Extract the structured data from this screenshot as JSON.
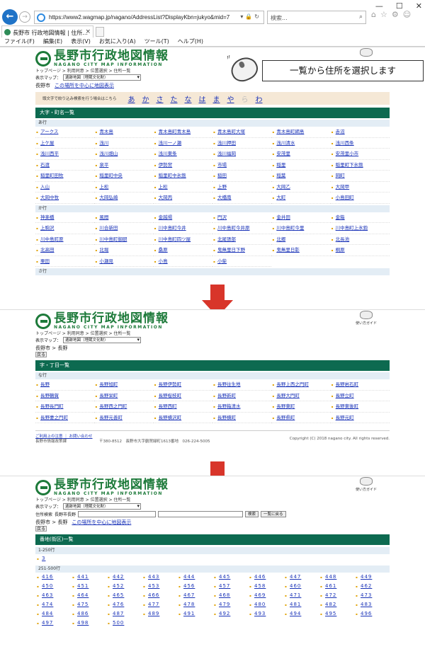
{
  "browser": {
    "url": "https://www2.wagmap.jp/nagano/AddressList?DisplayKbn=jukyo&mid=7",
    "search_placeholder": "検索...",
    "tab_title": "長野市 行政地図情報 | 住所...",
    "menu": [
      "ファイル(F)",
      "編集(E)",
      "表示(V)",
      "お気に入り(A)",
      "ツール(T)",
      "ヘルプ(H)"
    ]
  },
  "site": {
    "logo_jp": "長野市行政地図情報",
    "logo_en": "NAGANO CITY MAP INFORMATION",
    "guide_label": "使い方ガイド",
    "breadcrumb": "トップページ > 利用同意 > 位置選択 > 住所一覧",
    "map_label": "表示マップ：",
    "map_value": "遺跡地図（埋蔵文化財）",
    "center_link": "この場所を中心に地図表示",
    "back_label": "戻る"
  },
  "callout": "一覧から住所を選択します",
  "screen1": {
    "position": "長野市",
    "kana_note": "頭文字で絞り込み検索を行う場合はこちら",
    "kana": [
      "あ",
      "か",
      "さ",
      "た",
      "な",
      "は",
      "ま",
      "や",
      "ら",
      "わ"
    ],
    "section_title": "大字・町名一覧",
    "groups": [
      {
        "label": "あ行",
        "items": [
          "アークス",
          "青木島",
          "青木島町青木島",
          "青木島町大塚",
          "青木島町綱島",
          "赤沼",
          "上ケ屋",
          "浅川",
          "浅川一ノ瀬",
          "浅川押田",
          "浅川清水",
          "浅川西条",
          "浅川西平",
          "浅川畑山",
          "浅川東条",
          "浅川福岡",
          "安茂里",
          "安茂里小市",
          "石渡",
          "泉平",
          "伊勢宮",
          "市場",
          "稲里",
          "稲里町下氷鉋",
          "稲里町田牧",
          "稲里町中央",
          "稲里町中氷鉋",
          "稲田",
          "稲葉",
          "岡町",
          "入山",
          "上松",
          "上松",
          "上野",
          "大岡乙",
          "大岡甲",
          "大岡中牧",
          "大岡弘崎",
          "大岡丙",
          "大橋南",
          "大町",
          "小島田町"
        ]
      },
      {
        "label": "か行",
        "items": [
          "神楽橋",
          "風間",
          "金越場",
          "門沢",
          "金井田",
          "金箱",
          "上駒沢",
          "川合新田",
          "川中島町今井",
          "川中島町今井原",
          "川中島町今里",
          "川中島町上氷鉋",
          "川中島町原",
          "川中島町御厨",
          "川中島町四ツ屋",
          "北尾張部",
          "北郷",
          "北長池",
          "北高田",
          "北堀",
          "桑原",
          "鬼無里日下野",
          "鬼無里日影",
          "桐原",
          "栗田",
          "小瀬見",
          "小島",
          "小柴"
        ]
      },
      {
        "label": "さ行",
        "items": []
      }
    ]
  },
  "screen2": {
    "position": "長野市 > 長野",
    "section_title": "字・丁目一覧",
    "groups": [
      {
        "label": "な行",
        "items": [
          "長野",
          "長野旭町",
          "長野伊勢町",
          "長野往生地",
          "長野上西之門町",
          "長野岩石町",
          "長野鶴賀",
          "長野栄町",
          "長野桜枝町",
          "長野新町",
          "長野大門町",
          "長野立町",
          "長野長門町",
          "長野西之門町",
          "長野西町",
          "長野箱清水",
          "長野東町",
          "長野東後町",
          "長野妻之門町",
          "長野元善町",
          "長野横沢町",
          "長野横町",
          "長野県町",
          "長野元町"
        ]
      }
    ],
    "footer_links": "ご利用上の注意 ｜ お問い合わせ",
    "footer_org": "長野市情報政策課",
    "footer_addr": "〒380-8512　長野市大字鶴賀緑町1613番地　026-224-5005",
    "copyright": "Copyright (C) 2018 nagano city. All rights reserved."
  },
  "screen3": {
    "addr_search_label": "住所検索",
    "addr_search_field_label": "長野市長野",
    "search_button": "検索",
    "list_button": "一覧に戻る",
    "position": "長野市 > 長野",
    "section_title": "番地(街区)一覧",
    "groups": [
      {
        "label": "1-250行",
        "items": [
          "3"
        ]
      },
      {
        "label": "251-500行",
        "items": [
          "416",
          "441",
          "442",
          "443",
          "444",
          "445",
          "446",
          "447",
          "448",
          "449",
          "450",
          "451",
          "452",
          "453",
          "456",
          "457",
          "458",
          "460",
          "461",
          "462",
          "463",
          "464",
          "465",
          "466",
          "467",
          "468",
          "469",
          "471",
          "472",
          "473",
          "474",
          "475",
          "476",
          "477",
          "478",
          "479",
          "480",
          "481",
          "482",
          "483",
          "484",
          "486",
          "487",
          "489",
          "491",
          "492",
          "493",
          "494",
          "495",
          "496",
          "497",
          "498",
          "500"
        ]
      }
    ]
  },
  "colors": {
    "accent_green": "#0d6a50",
    "arrow_red": "#d8352a",
    "link_blue": "#1a33b8"
  }
}
